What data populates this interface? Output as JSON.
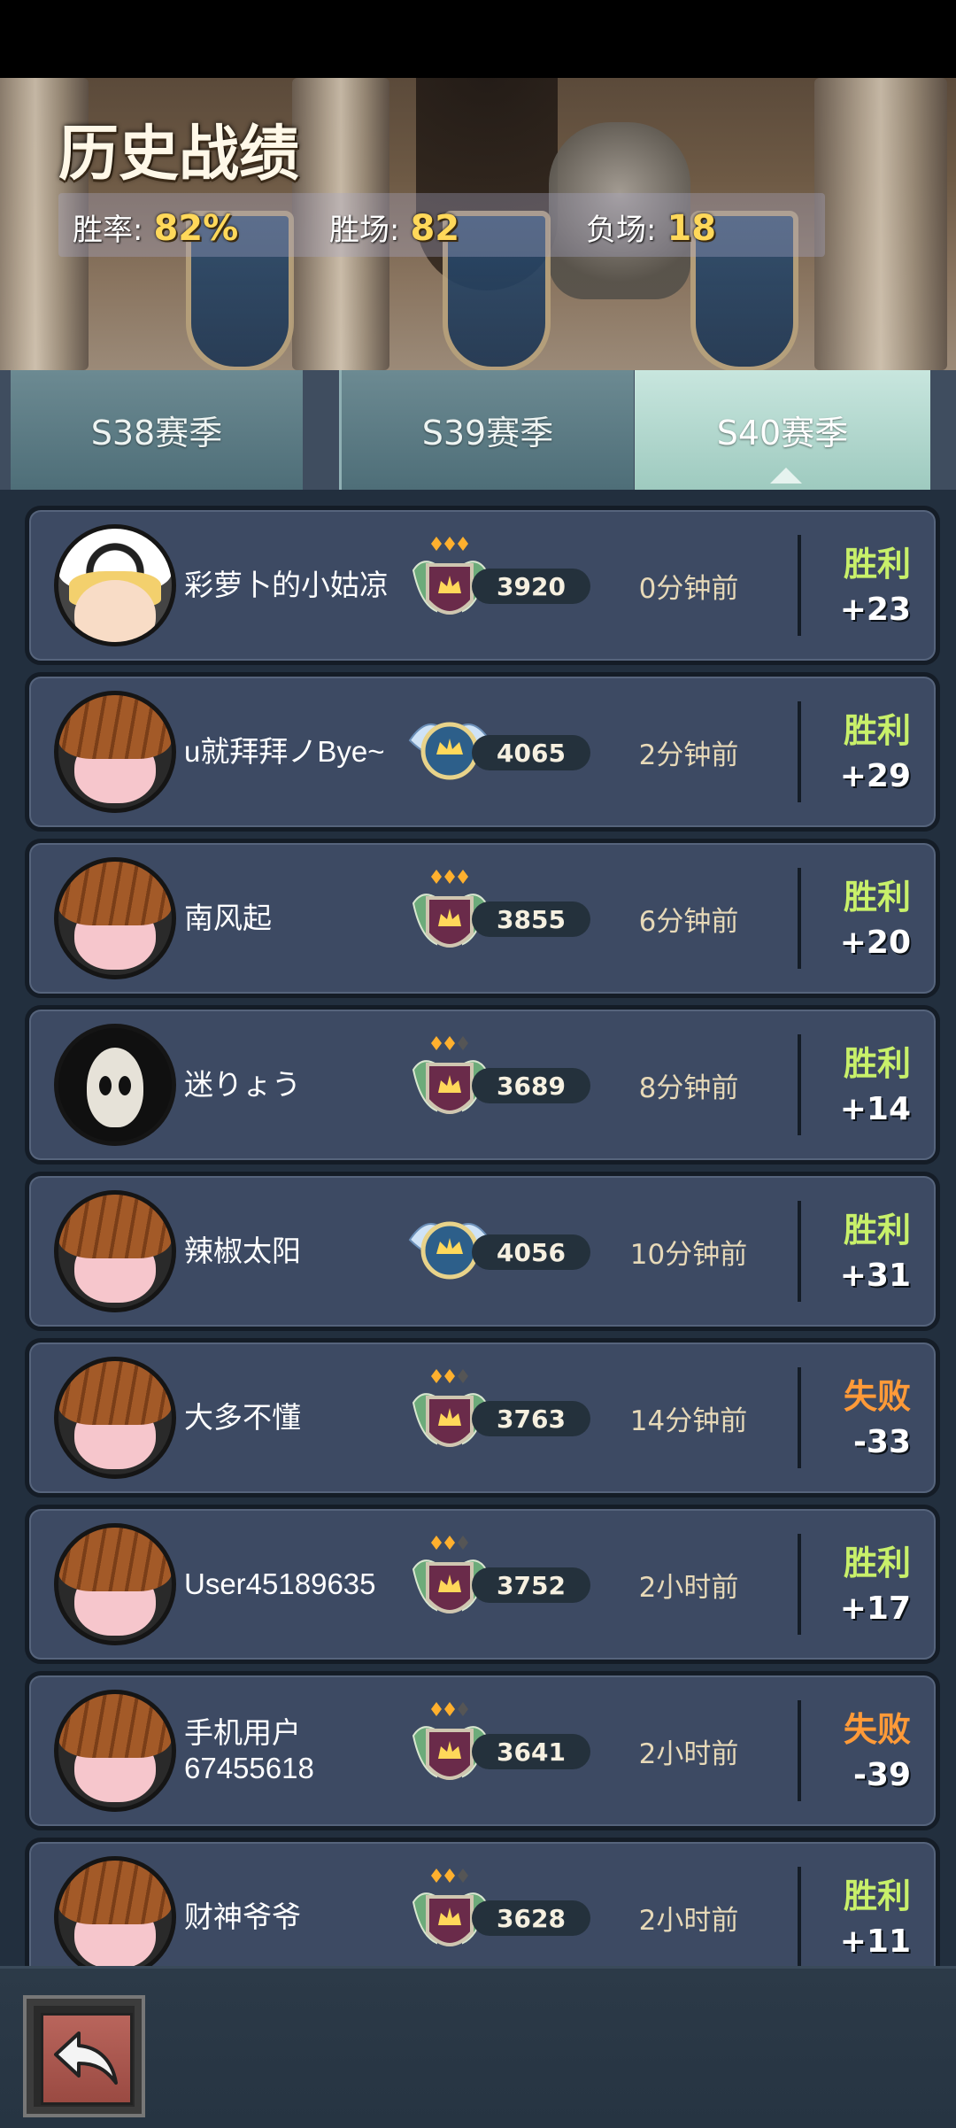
{
  "header": {
    "title": "历史战绩",
    "stats": [
      {
        "label": "胜率:",
        "value": "82%"
      },
      {
        "label": "胜场:",
        "value": "82"
      },
      {
        "label": "负场:",
        "value": "18"
      }
    ]
  },
  "tabs": [
    {
      "label": "S38赛季",
      "selected": false
    },
    {
      "label": "S39赛季",
      "selected": false
    },
    {
      "label": "S40赛季",
      "selected": true
    }
  ],
  "matches": [
    {
      "name": "彩萝卜的小姑凉",
      "avatar": "panda-hood-girl-avatar",
      "rank_badge": "gold-crown-emblem-3-stars",
      "score": "3920",
      "time": "0分钟前",
      "result": "胜利",
      "outcome": "win",
      "delta": "+23"
    },
    {
      "name": "u就拜拜ノBye~",
      "avatar": "pumpkin-hood-avatar",
      "rank_badge": "winged-crown-emblem",
      "score": "4065",
      "time": "2分钟前",
      "result": "胜利",
      "outcome": "win",
      "delta": "+29"
    },
    {
      "name": "南风起",
      "avatar": "pumpkin-hood-avatar",
      "rank_badge": "gold-crown-emblem-3-stars",
      "score": "3855",
      "time": "6分钟前",
      "result": "胜利",
      "outcome": "win",
      "delta": "+20"
    },
    {
      "name": "迷りょう",
      "avatar": "ghost-mask-avatar",
      "rank_badge": "gold-crown-emblem-2-stars",
      "score": "3689",
      "time": "8分钟前",
      "result": "胜利",
      "outcome": "win",
      "delta": "+14"
    },
    {
      "name": "辣椒太阳",
      "avatar": "pumpkin-hood-avatar",
      "rank_badge": "winged-crown-emblem",
      "score": "4056",
      "time": "10分钟前",
      "result": "胜利",
      "outcome": "win",
      "delta": "+31"
    },
    {
      "name": "大多不懂",
      "avatar": "pumpkin-hood-avatar",
      "rank_badge": "gold-crown-emblem-2-stars",
      "score": "3763",
      "time": "14分钟前",
      "result": "失败",
      "outcome": "lose",
      "delta": "-33"
    },
    {
      "name": "User45189635",
      "avatar": "pumpkin-hood-avatar",
      "rank_badge": "gold-crown-emblem-2-stars",
      "score": "3752",
      "time": "2小时前",
      "result": "胜利",
      "outcome": "win",
      "delta": "+17"
    },
    {
      "name": "手机用户67455618",
      "avatar": "pumpkin-hood-avatar",
      "rank_badge": "gold-crown-emblem-2-stars",
      "score": "3641",
      "time": "2小时前",
      "result": "失败",
      "outcome": "lose",
      "delta": "-39"
    },
    {
      "name": "财神爷爷",
      "avatar": "pumpkin-hood-avatar",
      "rank_badge": "gold-crown-emblem-2-stars",
      "score": "3628",
      "time": "2小时前",
      "result": "胜利",
      "outcome": "win",
      "delta": "+11"
    }
  ],
  "bottom": {
    "back_icon": "back-arrow-icon"
  },
  "colors": {
    "win": "#c8f06a",
    "lose": "#ff9a38",
    "row_bg": "#3d4a63",
    "gold": "#ffd85a"
  }
}
